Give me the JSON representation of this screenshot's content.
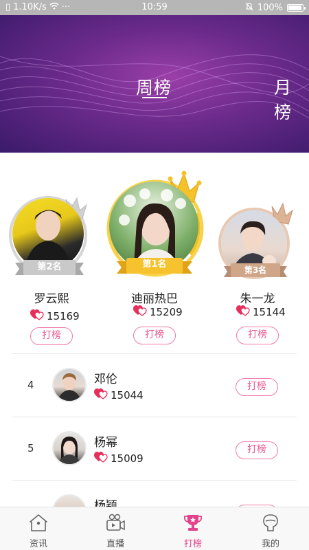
{
  "status_bar": {
    "network_speed": "1.10K/s",
    "dots": "···",
    "time": "10:59",
    "battery": "100%",
    "battery_level": 1.0
  },
  "banner": {
    "tabs": [
      {
        "label": "周榜",
        "active": true
      },
      {
        "label": "月榜",
        "active": false
      }
    ]
  },
  "podium": [
    {
      "rank_label": "第1名",
      "name": "迪丽热巴",
      "votes": "15209",
      "button": "打榜"
    },
    {
      "rank_label": "第2名",
      "name": "罗云熙",
      "votes": "15169",
      "button": "打榜"
    },
    {
      "rank_label": "第3名",
      "name": "朱一龙",
      "votes": "15144",
      "button": "打榜"
    }
  ],
  "list": [
    {
      "rank": "4",
      "name": "邓伦",
      "votes": "15044",
      "button": "打榜"
    },
    {
      "rank": "5",
      "name": "杨幂",
      "votes": "15009",
      "button": "打榜"
    },
    {
      "rank": "",
      "name": "杨颖",
      "votes": "",
      "button": "打榜"
    }
  ],
  "bottom_nav": [
    {
      "label": "资讯",
      "icon": "home-icon",
      "active": false
    },
    {
      "label": "直播",
      "icon": "video-icon",
      "active": false
    },
    {
      "label": "打榜",
      "icon": "trophy-icon",
      "active": true
    },
    {
      "label": "我的",
      "icon": "profile-icon",
      "active": false
    }
  ],
  "colors": {
    "accent": "#e2438a",
    "button_border": "#f07aa8",
    "banner_purple": "#6a2a8a",
    "gold": "#f2b51d",
    "silver": "#bdbdbd",
    "bronze": "#d9a784"
  }
}
